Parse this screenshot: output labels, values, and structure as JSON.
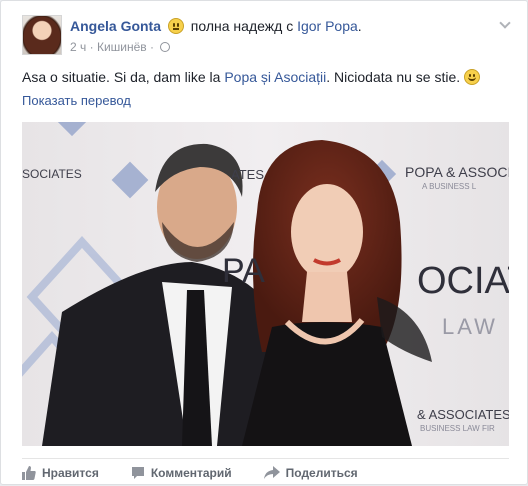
{
  "post": {
    "author": "Angela Gonta",
    "feeling": "полна надежд",
    "with_prefix": "с",
    "tagged_person": "Igor Popa",
    "tagged_suffix": ".",
    "time": "2 ч",
    "separator": "·",
    "location": "Кишинёв",
    "text_part1": "Asa o situatie. Si da, dam like la ",
    "text_link": "Popa și Asociații",
    "text_part2": ". Niciodata nu se stie.",
    "translate_link": "Показать перевод"
  },
  "photo": {
    "backdrop": {
      "associates_left": "SOCIATES",
      "popa_associates": "POPA & ASSOCI",
      "business_law": "A BUSINESS L",
      "pa": "PA",
      "ociat": "OCIAT",
      "law": "LAW",
      "associates_bottom": "& ASSOCIATES",
      "business_bottom": "BUSINESS LAW FIR",
      "ates_left": "ATES"
    }
  },
  "actions": {
    "like": "Нравится",
    "comment": "Комментарий",
    "share": "Поделиться"
  },
  "colors": {
    "link": "#365899",
    "meta": "#90949c",
    "action_text": "#616770"
  }
}
